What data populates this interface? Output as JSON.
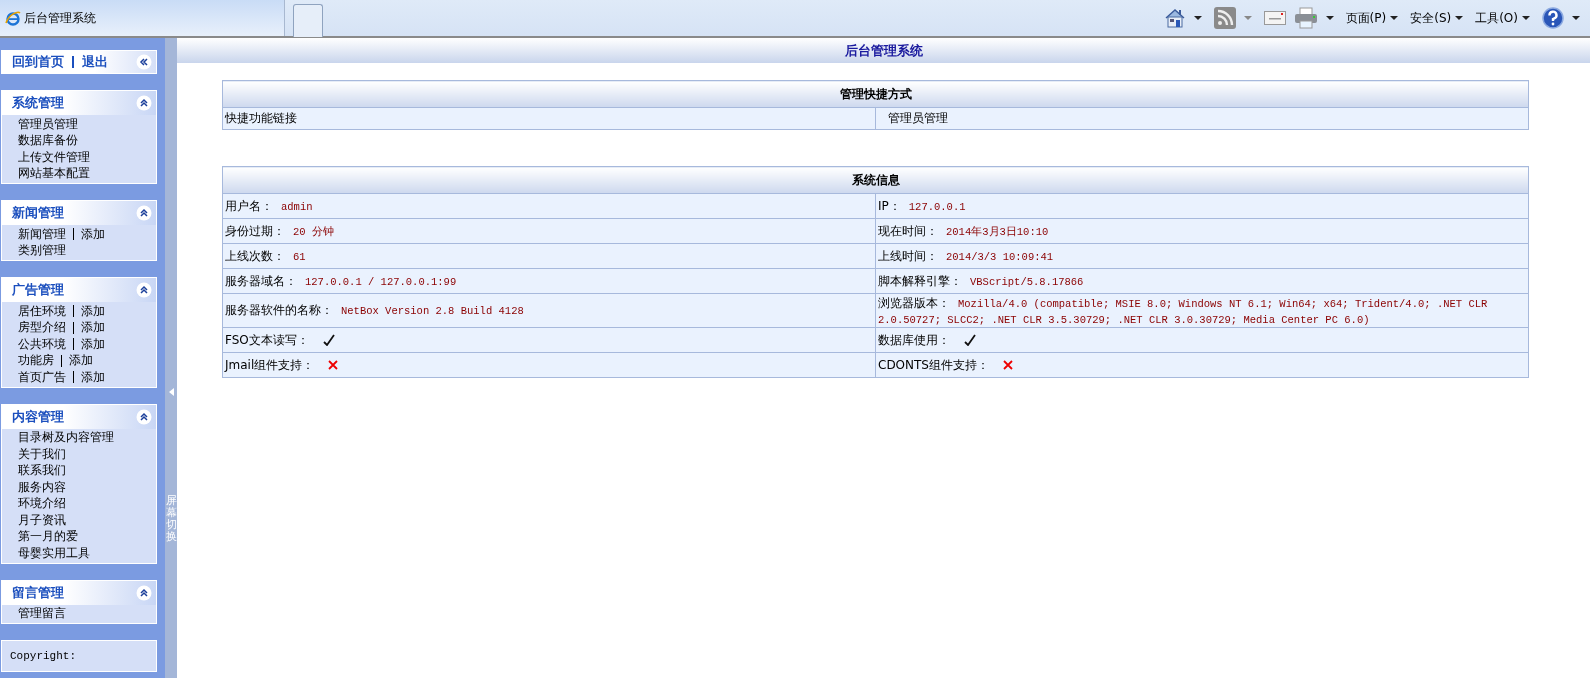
{
  "browser": {
    "tab_title": "后台管理系统",
    "menus": [
      "页面(P)",
      "安全(S)",
      "工具(O)"
    ]
  },
  "sidebar": {
    "top_links": [
      "回到首页",
      "退出"
    ],
    "groups": [
      {
        "title": "系统管理",
        "expanded": true,
        "items": [
          {
            "label": "管理员管理"
          },
          {
            "label": "数据库备份"
          },
          {
            "label": "上传文件管理"
          },
          {
            "label": "网站基本配置"
          }
        ]
      },
      {
        "title": "新闻管理",
        "expanded": true,
        "items": [
          {
            "label": "新闻管理",
            "add": "添加"
          },
          {
            "label": "类别管理"
          }
        ]
      },
      {
        "title": "广告管理",
        "expanded": true,
        "items": [
          {
            "label": "居住环境",
            "add": "添加"
          },
          {
            "label": "房型介绍",
            "add": "添加"
          },
          {
            "label": "公共环境",
            "add": "添加"
          },
          {
            "label": "功能房",
            "add": "添加"
          },
          {
            "label": "首页广告",
            "add": "添加"
          }
        ]
      },
      {
        "title": "内容管理",
        "expanded": true,
        "items": [
          {
            "label": "目录树及内容管理"
          },
          {
            "label": "关于我们"
          },
          {
            "label": "联系我们"
          },
          {
            "label": "服务内容"
          },
          {
            "label": "环境介绍"
          },
          {
            "label": "月子资讯"
          },
          {
            "label": "第一月的爱"
          },
          {
            "label": "母婴实用工具"
          }
        ]
      },
      {
        "title": "留言管理",
        "expanded": true,
        "items": [
          {
            "label": "管理留言"
          }
        ]
      }
    ],
    "copyright": "Copyright:"
  },
  "splitter": {
    "label": "屏幕切换"
  },
  "page_title": "后台管理系统",
  "shortcuts": {
    "title": "管理快捷方式",
    "label": "快捷功能链接",
    "links": [
      "管理员管理"
    ]
  },
  "system_info": {
    "title": "系统信息",
    "rows": [
      [
        {
          "label": "用户名：",
          "value": "admin"
        },
        {
          "label": "IP：",
          "value": "127.0.0.1"
        }
      ],
      [
        {
          "label": "身份过期：",
          "value": "20 分钟"
        },
        {
          "label": "现在时间：",
          "value": "2014年3月3日10:10"
        }
      ],
      [
        {
          "label": "上线次数：",
          "value": "61"
        },
        {
          "label": "上线时间：",
          "value": "2014/3/3 10:09:41"
        }
      ],
      [
        {
          "label": "服务器域名：",
          "value": "127.0.0.1 / 127.0.0.1:99"
        },
        {
          "label": "脚本解释引擎：",
          "value": "VBScript/5.8.17866"
        }
      ],
      [
        {
          "label": "服务器软件的名称：",
          "value": "NetBox Version 2.8 Build 4128"
        },
        {
          "label": "浏览器版本：",
          "value": "Mozilla/4.0 (compatible; MSIE 8.0; Windows NT 6.1; Win64; x64; Trident/4.0; .NET CLR 2.0.50727; SLCC2; .NET CLR 3.5.30729; .NET CLR 3.0.30729; Media Center PC 6.0)"
        }
      ],
      [
        {
          "label": "FSO文本读写：",
          "supported": true
        },
        {
          "label": "数据库使用：",
          "supported": true
        }
      ],
      [
        {
          "label": "Jmail组件支持：",
          "supported": false
        },
        {
          "label": "CDONTS组件支持：",
          "supported": false
        }
      ]
    ]
  }
}
